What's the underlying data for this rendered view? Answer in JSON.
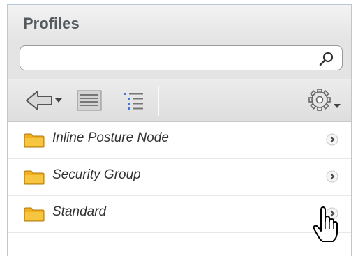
{
  "panel": {
    "title": "Profiles"
  },
  "search": {
    "value": "",
    "placeholder": ""
  },
  "toolbar": {
    "buttons": [
      {
        "name": "back",
        "icon": "arrow-left-icon"
      },
      {
        "name": "list-view",
        "icon": "list-view-icon"
      },
      {
        "name": "tree-view",
        "icon": "tree-view-icon"
      },
      {
        "name": "settings",
        "icon": "gear-icon"
      }
    ]
  },
  "items": [
    {
      "label": "Inline Posture Node",
      "icon": "folder-icon"
    },
    {
      "label": "Security Group",
      "icon": "folder-icon"
    },
    {
      "label": "Standard",
      "icon": "folder-icon"
    }
  ],
  "colors": {
    "folder": "#f0b020",
    "title_text": "#555a5f",
    "header_bg": "#e4e4e4",
    "border": "#b8c7d9"
  }
}
